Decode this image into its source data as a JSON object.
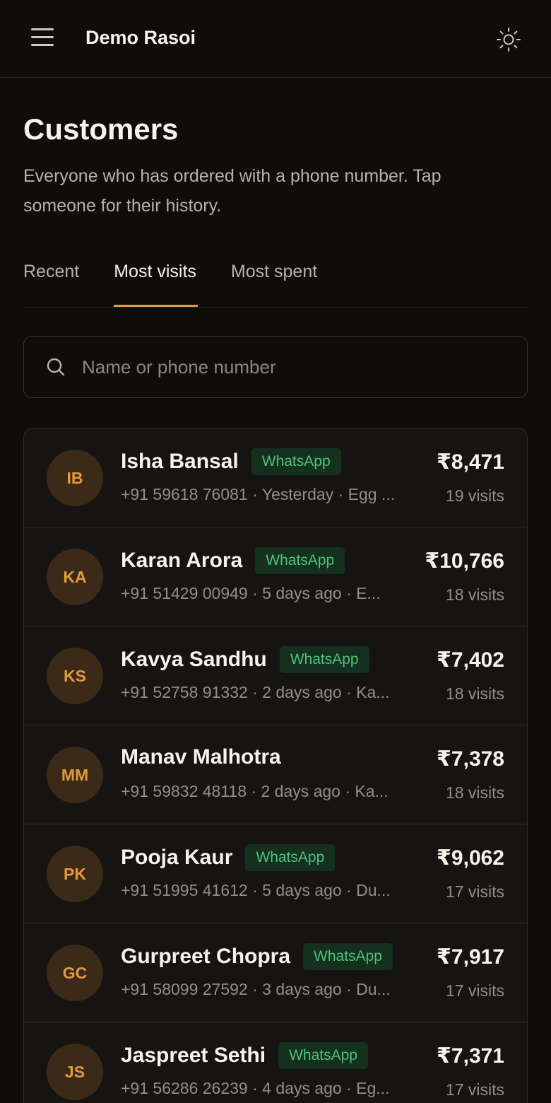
{
  "header": {
    "app_title": "Demo Rasoi"
  },
  "page": {
    "title": "Customers",
    "subtitle": "Everyone who has ordered with a phone number. Tap someone for their history."
  },
  "tabs": [
    {
      "label": "Recent"
    },
    {
      "label": "Most visits",
      "active": true
    },
    {
      "label": "Most spent"
    }
  ],
  "search": {
    "placeholder": "Name or phone number"
  },
  "colors": {
    "accent": "#e39a3b",
    "whatsapp_green": "#4cc37a",
    "background": "#0e0d0c"
  },
  "customers": [
    {
      "initials": "IB",
      "name": "Isha Bansal",
      "whatsapp": "WhatsApp",
      "meta": "+91 59618 76081 · Yesterday · Egg ...",
      "amount": "₹8,471",
      "visits": "19 visits"
    },
    {
      "initials": "KA",
      "name": "Karan Arora",
      "whatsapp": "WhatsApp",
      "meta": "+91 51429 00949 · 5 days ago · E...",
      "amount": "₹10,766",
      "visits": "18 visits"
    },
    {
      "initials": "KS",
      "name": "Kavya Sandhu",
      "whatsapp": "WhatsApp",
      "meta": "+91 52758 91332 · 2 days ago · Ka...",
      "amount": "₹7,402",
      "visits": "18 visits"
    },
    {
      "initials": "MM",
      "name": "Manav Malhotra",
      "whatsapp": "",
      "meta": "+91 59832 48118 · 2 days ago · Ka...",
      "amount": "₹7,378",
      "visits": "18 visits"
    },
    {
      "initials": "PK",
      "name": "Pooja Kaur",
      "whatsapp": "WhatsApp",
      "meta": "+91 51995 41612 · 5 days ago · Du...",
      "amount": "₹9,062",
      "visits": "17 visits"
    },
    {
      "initials": "GC",
      "name": "Gurpreet Chopra",
      "whatsapp": "WhatsApp",
      "meta": "+91 58099 27592 · 3 days ago · Du...",
      "amount": "₹7,917",
      "visits": "17 visits"
    },
    {
      "initials": "JS",
      "name": "Jaspreet Sethi",
      "whatsapp": "WhatsApp",
      "meta": "+91 56286 26239 · 4 days ago · Eg...",
      "amount": "₹7,371",
      "visits": "17 visits"
    }
  ]
}
